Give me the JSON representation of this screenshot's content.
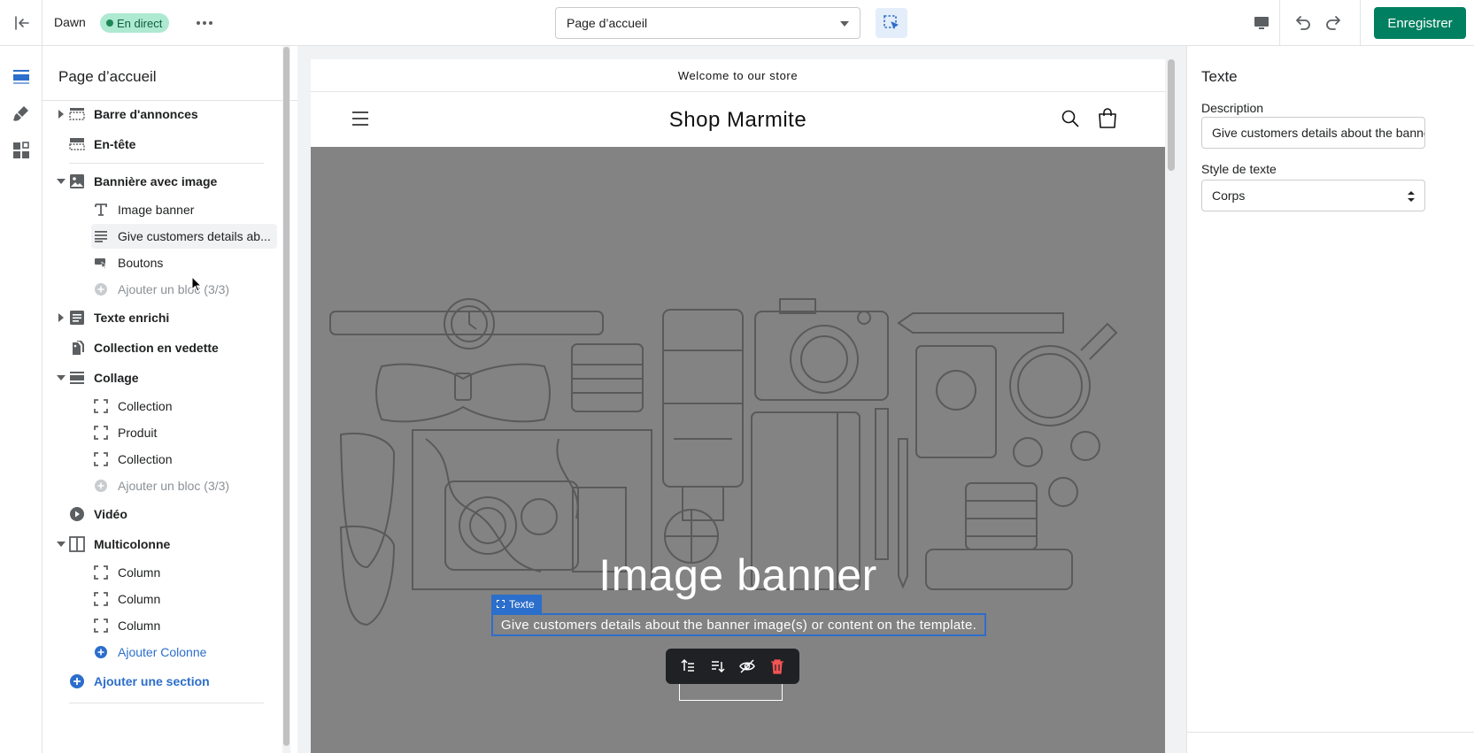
{
  "topbar": {
    "theme_name": "Dawn",
    "live_badge": "En direct",
    "page_select": "Page d’accueil",
    "save_label": "Enregistrer"
  },
  "sidebar": {
    "title": "Page d’accueil",
    "rows": [
      {
        "label": "Barre d'annonces"
      },
      {
        "label": "En-tête"
      },
      {
        "label": "Bannière avec image"
      },
      {
        "label": "Image banner"
      },
      {
        "label": "Give customers details ab..."
      },
      {
        "label": "Boutons"
      },
      {
        "label": "Ajouter un bloc (3/3)"
      },
      {
        "label": "Texte enrichi"
      },
      {
        "label": "Collection en vedette"
      },
      {
        "label": "Collage"
      },
      {
        "label": "Collection"
      },
      {
        "label": "Produit"
      },
      {
        "label": "Collection"
      },
      {
        "label": "Ajouter un bloc (3/3)"
      },
      {
        "label": "Vidéo"
      },
      {
        "label": "Multicolonne"
      },
      {
        "label": "Column"
      },
      {
        "label": "Column"
      },
      {
        "label": "Column"
      },
      {
        "label": "Ajouter Colonne"
      },
      {
        "label": "Ajouter une section"
      }
    ]
  },
  "preview": {
    "announcement": "Welcome to our store",
    "store_name": "Shop Marmite",
    "banner_title": "Image banner",
    "block_tag": "Texte",
    "banner_description": "Give customers details about the banner image(s) or content on the template."
  },
  "settings": {
    "title": "Texte",
    "description_label": "Description",
    "description_value": "Give customers details about the banner image(s) or content on the template.",
    "style_label": "Style de texte",
    "style_value": "Corps"
  },
  "colors": {
    "accent_blue": "#2c6ecb",
    "save_green": "#008060",
    "badge_bg": "#aee9d1"
  }
}
